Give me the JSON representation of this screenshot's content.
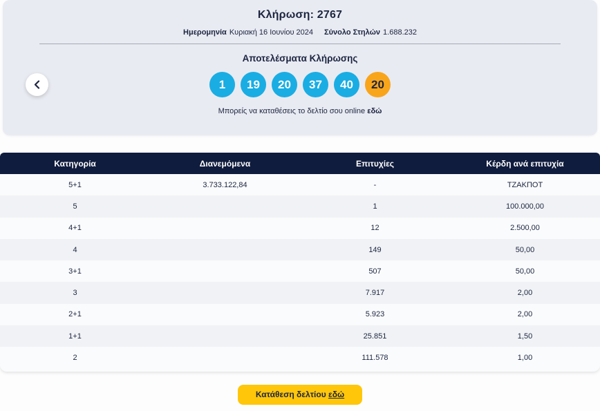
{
  "draw": {
    "title": "Κλήρωση: 2767",
    "date_label": "Ημερομηνία",
    "date_value": "Κυριακή 16 Ιουνίου 2024",
    "columns_label": "Σύνολο Στηλών",
    "columns_value": "1.688.232",
    "results_title": "Αποτελέσματα Κλήρωσης",
    "numbers": [
      "1",
      "19",
      "20",
      "37",
      "40"
    ],
    "joker_number": "20",
    "online_text": "Μπορείς να καταθέσεις το δελτίο σου online",
    "online_link_text": "εδώ"
  },
  "table": {
    "headers": [
      "Κατηγορία",
      "Διανεμόμενα",
      "Επιτυχίες",
      "Κέρδη ανά επιτυχία"
    ],
    "rows": [
      [
        "5+1",
        "3.733.122,84",
        "-",
        "ΤΖΑΚΠΟΤ"
      ],
      [
        "5",
        "",
        "1",
        "100.000,00"
      ],
      [
        "4+1",
        "",
        "12",
        "2.500,00"
      ],
      [
        "4",
        "",
        "149",
        "50,00"
      ],
      [
        "3+1",
        "",
        "507",
        "50,00"
      ],
      [
        "3",
        "",
        "7.917",
        "2,00"
      ],
      [
        "2+1",
        "",
        "5.923",
        "2,00"
      ],
      [
        "1+1",
        "",
        "25.851",
        "1,50"
      ],
      [
        "2",
        "",
        "111.578",
        "1,00"
      ]
    ]
  },
  "footer": {
    "button_text": "Κατάθεση δελτίου",
    "button_link_text": "εδώ"
  },
  "colors": {
    "ball_blue": "#1aade3",
    "ball_gold": "#f9a51b",
    "header_navy": "#101c3d",
    "button_yellow": "#ffc60a",
    "card_grey": "#e9ebf2"
  }
}
